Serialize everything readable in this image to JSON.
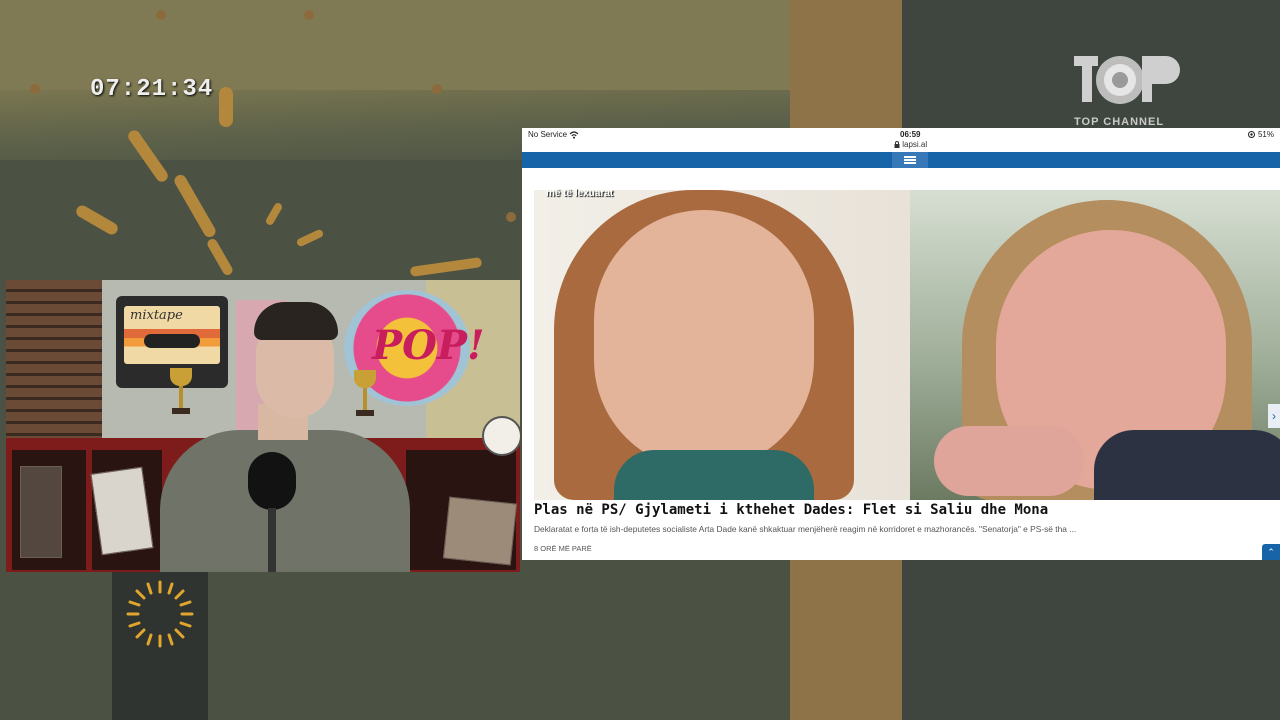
{
  "clock": "07:21:34",
  "channel_logo": {
    "text": "TOP CHANNEL",
    "icon": "top-channel-logo-icon"
  },
  "studio": {
    "cassette_title": "mixtape",
    "pop_text": "POP!"
  },
  "tablet": {
    "status_bar": {
      "carrier": "No Service",
      "time": "06:59",
      "url": "lapsi.al",
      "battery": "51%"
    },
    "menu_icon": "hamburger-menu-icon",
    "photo_label": "më të lexuarat",
    "article": {
      "headline": "Plas në PS/ Gjylameti i kthehet Dades: Flet si Saliu dhe Mona",
      "summary": "Deklaratat e forta të ish-deputetes socialiste Arta Dade kanë shkaktuar menjëherë reagim në korridoret e mazhorancës. \"Senatorja\" e PS-së tha ...",
      "time_ago": "8 ORË MË PARË"
    }
  },
  "colors": {
    "accent_blue": "#1864a8",
    "background_olive": "#4b5244",
    "ochre": "#8d7347"
  }
}
